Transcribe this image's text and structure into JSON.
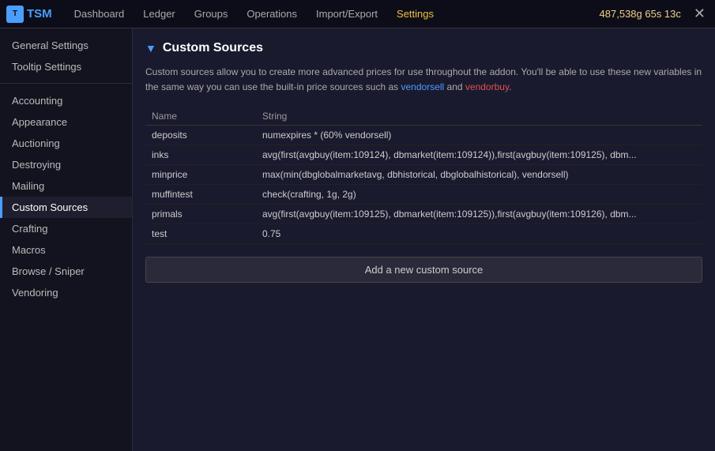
{
  "topnav": {
    "logo_text": "TSM",
    "nav_items": [
      {
        "label": "Dashboard",
        "active": false
      },
      {
        "label": "Ledger",
        "active": false
      },
      {
        "label": "Groups",
        "active": false
      },
      {
        "label": "Operations",
        "active": false
      },
      {
        "label": "Import/Export",
        "active": false
      },
      {
        "label": "Settings",
        "active": true
      }
    ],
    "gold": "487,538g 65s 13c",
    "close_icon": "✕"
  },
  "sidebar": {
    "top_items": [
      {
        "label": "General Settings",
        "active": false
      },
      {
        "label": "Tooltip Settings",
        "active": false
      }
    ],
    "sections": [
      {
        "items": [
          {
            "label": "Accounting",
            "active": false
          },
          {
            "label": "Appearance",
            "active": false
          },
          {
            "label": "Auctioning",
            "active": false
          },
          {
            "label": "Destroying",
            "active": false
          },
          {
            "label": "Mailing",
            "active": false
          },
          {
            "label": "Custom Sources",
            "active": true
          },
          {
            "label": "Crafting",
            "active": false
          },
          {
            "label": "Macros",
            "active": false
          },
          {
            "label": "Browse / Sniper",
            "active": false
          },
          {
            "label": "Vendoring",
            "active": false
          }
        ]
      }
    ]
  },
  "main": {
    "section_arrow": "▼",
    "section_title": "Custom Sources",
    "description_parts": [
      "Custom sources allow you to create more advanced prices for use throughout the addon. You'll be able to use these new variables in the same way you can use the built-in price sources such as ",
      "vendorsell",
      " and ",
      "vendorbuy",
      "."
    ],
    "table": {
      "columns": [
        "Name",
        "String"
      ],
      "rows": [
        {
          "name": "deposits",
          "string": "numexpires * (60% vendorsell)"
        },
        {
          "name": "inks",
          "string": "avg(first(avgbuy(item:109124), dbmarket(item:109124)),first(avgbuy(item:109125), dbm..."
        },
        {
          "name": "minprice",
          "string": "max(min(dbglobalmarketavg, dbhistorical, dbglobalhistorical), vendorsell)"
        },
        {
          "name": "muffintest",
          "string": "check(crafting, 1g, 2g)"
        },
        {
          "name": "primals",
          "string": "avg(first(avgbuy(item:109125), dbmarket(item:109125)),first(avgbuy(item:109126), dbm..."
        },
        {
          "name": "test",
          "string": "0.75"
        }
      ]
    },
    "add_button_label": "Add a new custom source"
  }
}
